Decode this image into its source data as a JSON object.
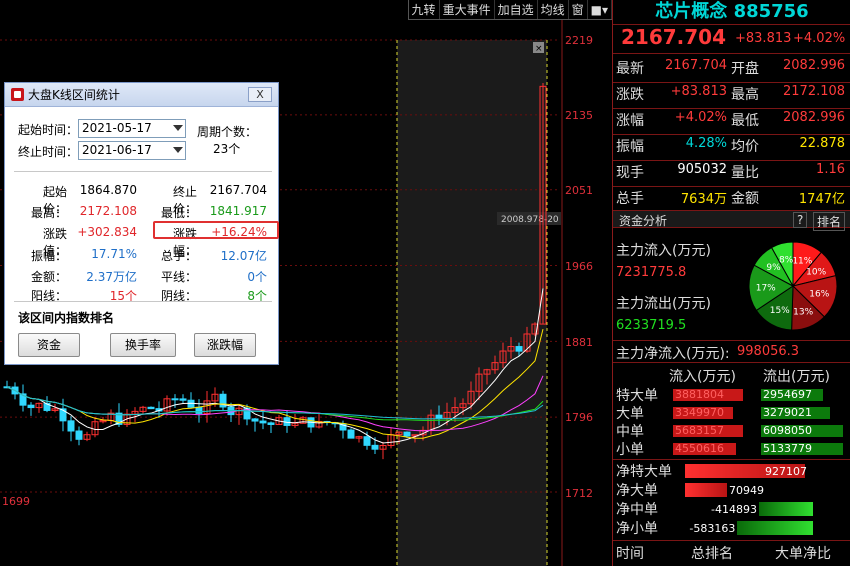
{
  "toolbar": {
    "buttons": [
      "九转",
      "重大事件",
      "加自选",
      "均线",
      "窗"
    ]
  },
  "chart": {
    "price_ticks": [
      "2219",
      "2135",
      "2051",
      "1966",
      "1881",
      "1796",
      "1712"
    ],
    "left_tick": "1699",
    "crosshair_label": "2008.978",
    "crosshair_label_tail": "-20",
    "close_icon": "close-icon"
  },
  "chart_data": {
    "type": "candlestick",
    "ylim": [
      1699,
      2219
    ],
    "y_ticks": [
      2219,
      2135,
      2051,
      1966,
      1881,
      1796,
      1712
    ],
    "selected_range": {
      "start": "2021-05-17",
      "end": "2021-06-17"
    },
    "ma_lines": [
      "white",
      "yellow",
      "magenta",
      "green",
      "cyan"
    ]
  },
  "dialog": {
    "title": "大盘K线区间统计",
    "close": "X",
    "start_label": "起始时间：",
    "start_value": "2021-05-17",
    "end_label": "终止时间：",
    "end_value": "2021-06-17",
    "period_label": "周期个数：",
    "period_value": "23个",
    "stats": [
      {
        "label": "起始价：",
        "value": "1864.870",
        "color": "black"
      },
      {
        "label": "终止价：",
        "value": "2167.704",
        "color": "black"
      },
      {
        "label": "最高：",
        "value": "2172.108",
        "color": "red"
      },
      {
        "label": "最低：",
        "value": "1841.917",
        "color": "green"
      },
      {
        "label": "涨跌值：",
        "value": "+302.834",
        "color": "red"
      },
      {
        "label": "涨跌幅：",
        "value": "+16.24%",
        "color": "red"
      },
      {
        "label": "振幅：",
        "value": "17.71%",
        "color": "blue"
      },
      {
        "label": "总手：",
        "value": "12.07亿",
        "color": "blue"
      },
      {
        "label": "金额：",
        "value": "2.37万亿",
        "color": "blue"
      },
      {
        "label": "平线：",
        "value": "0个",
        "color": "blue"
      },
      {
        "label": "阳线：",
        "value": "15个",
        "color": "red"
      },
      {
        "label": "阴线：",
        "value": "8个",
        "color": "green"
      }
    ],
    "rank_label": "该区间内指数排名",
    "btn_funds": "资金",
    "btn_turnover": "换手率",
    "btn_change": "涨跌幅"
  },
  "quote": {
    "name": "芯片概念",
    "code": "885756",
    "price": "2167.704",
    "change": "+83.813",
    "change_pct": "+4.02%",
    "rows": [
      {
        "l1": "最新",
        "v1": "2167.704",
        "c1": "rp-red",
        "l2": "开盘",
        "v2": "2082.996",
        "c2": "rp-red"
      },
      {
        "l1": "涨跌",
        "v1": "+83.813",
        "c1": "rp-red",
        "l2": "最高",
        "v2": "2172.108",
        "c2": "rp-red"
      },
      {
        "l1": "涨幅",
        "v1": "+4.02%",
        "c1": "rp-red",
        "l2": "最低",
        "v2": "2082.996",
        "c2": "rp-red"
      },
      {
        "l1": "振幅",
        "v1": "4.28%",
        "c1": "cyan",
        "l2": "均价",
        "v2": "22.878",
        "c2": "yellow"
      },
      {
        "l1": "现手",
        "v1": "905032",
        "c1": "white",
        "l2": "量比",
        "v2": "1.16",
        "c2": "rp-red"
      },
      {
        "l1": "总手",
        "v1": "7634万",
        "c1": "yellow",
        "l2": "金额",
        "v2": "1747亿",
        "c2": "yellow"
      }
    ]
  },
  "fund": {
    "header": "资金分析",
    "help": "?",
    "rank": "排名",
    "inflow_label": "主力流入(万元)",
    "inflow_value": "7231775.8",
    "outflow_label": "主力流出(万元)",
    "outflow_value": "6233719.5",
    "net_label": "主力净流入(万元):",
    "net_value": "998056.3",
    "pie": [
      {
        "label": "11%",
        "color": "#ff1a1a",
        "value": 11
      },
      {
        "label": "10%",
        "color": "#e01818",
        "value": 10
      },
      {
        "label": "16%",
        "color": "#b81414",
        "value": 16
      },
      {
        "label": "13%",
        "color": "#8a0e0e",
        "value": 13
      },
      {
        "label": "15%",
        "color": "#0e6a0e",
        "value": 15
      },
      {
        "label": "17%",
        "color": "#1a9a1a",
        "value": 17
      },
      {
        "label": "9%",
        "color": "#22c022",
        "value": 9
      },
      {
        "label": "8%",
        "color": "#30e030",
        "value": 8
      }
    ]
  },
  "flow_table": {
    "in_header": "流入(万元)",
    "out_header": "流出(万元)",
    "rows": [
      {
        "label": "特大单",
        "in": "3881804",
        "out": "2954697",
        "in_frac": 1.0,
        "out_frac": 0.76
      },
      {
        "label": "大单",
        "in": "3349970",
        "out": "3279021",
        "in_frac": 0.86,
        "out_frac": 0.84
      },
      {
        "label": "中单",
        "in": "5683157",
        "out": "6098050",
        "in_frac": 1.0,
        "out_frac": 1.0
      },
      {
        "label": "小单",
        "in": "4550616",
        "out": "5133779",
        "in_frac": 0.9,
        "out_frac": 1.0
      }
    ]
  },
  "net_table": {
    "rows": [
      {
        "label": "净特大单",
        "value": "927107",
        "kind": "pos",
        "frac": 1.0
      },
      {
        "label": "净大单",
        "value": "70949",
        "kind": "pos",
        "frac": 0.35
      },
      {
        "label": "净中单",
        "value": "-414893",
        "kind": "neg",
        "frac": 0.45
      },
      {
        "label": "净小单",
        "value": "-583163",
        "kind": "neg",
        "frac": 0.63
      }
    ]
  },
  "footer": {
    "time": "时间",
    "total_rank": "总排名",
    "big_ratio": "大单净比"
  }
}
